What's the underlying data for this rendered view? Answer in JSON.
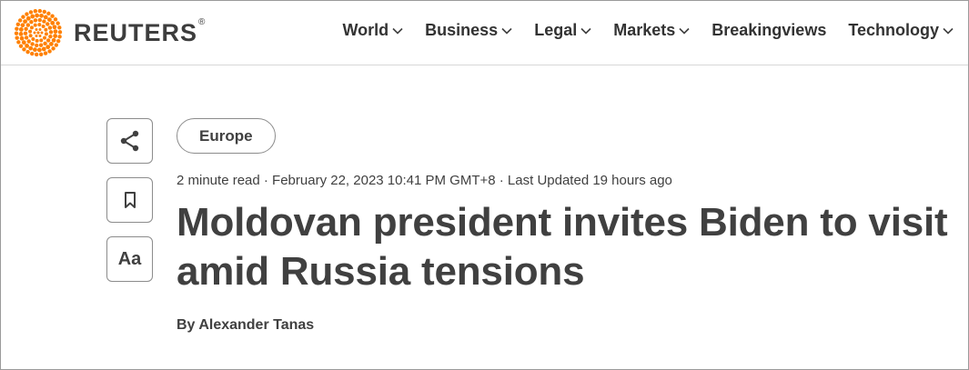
{
  "brand": {
    "name": "REUTERS",
    "registered": "®",
    "logo_color": "#ff8000"
  },
  "nav": {
    "items": [
      {
        "label": "World",
        "has_dropdown": true
      },
      {
        "label": "Business",
        "has_dropdown": true
      },
      {
        "label": "Legal",
        "has_dropdown": true
      },
      {
        "label": "Markets",
        "has_dropdown": true
      },
      {
        "label": "Breakingviews",
        "has_dropdown": false
      },
      {
        "label": "Technology",
        "has_dropdown": true
      }
    ]
  },
  "rail": {
    "share_icon": "share-icon",
    "bookmark_icon": "bookmark-icon",
    "text_size_label": "Aa"
  },
  "article": {
    "section_tag": "Europe",
    "meta": "2 minute read · February 22, 2023 10:41 PM GMT+8 · Last Updated 19 hours ago",
    "headline": "Moldovan president invites Biden to visit amid Russia tensions",
    "byline_prefix": "By",
    "author": "Alexander Tanas"
  }
}
